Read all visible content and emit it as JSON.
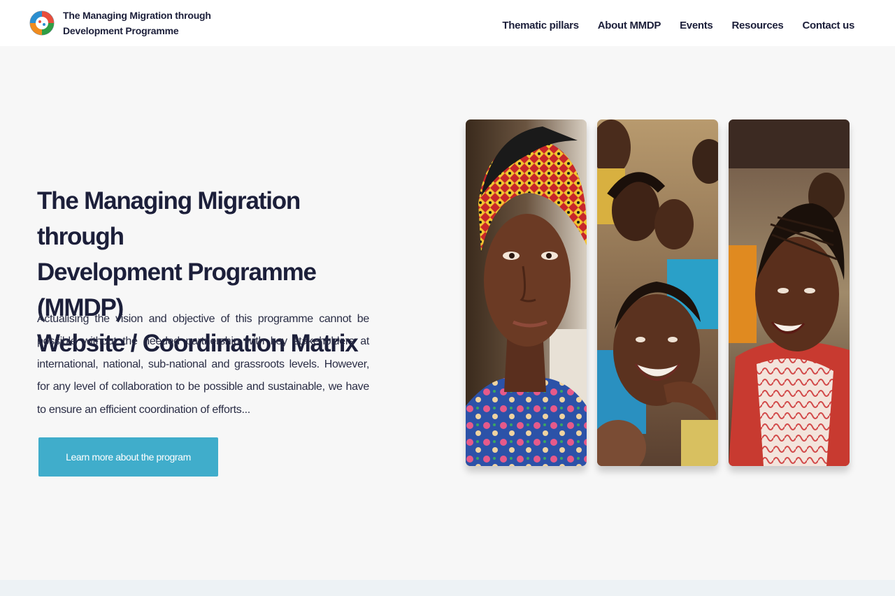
{
  "header": {
    "brand_line1": "The Managing Migration through",
    "brand_line2": "Development Programme",
    "logo_icon": "mmdp-logo-icon"
  },
  "nav": {
    "items": [
      {
        "label": "Thematic pillars"
      },
      {
        "label": "About MMDP"
      },
      {
        "label": "Events"
      },
      {
        "label": "Resources"
      },
      {
        "label": "Contact us"
      }
    ]
  },
  "hero": {
    "title_lines": [
      "The Managing Migration through",
      "Development Programme (MMDP)",
      "Website / Coordination Matrix"
    ],
    "text": "Actualising the vision and objective of this programme cannot be possible without the needed partnership with key stakeholders at international, national, sub-national and grassroots levels. However, for any level of collaboration to be possible and sustainable, we have to ensure an efficient coordination of efforts...",
    "cta_label": "Learn more about the program",
    "cta_color": "#40adcb"
  },
  "photos": [
    {
      "subject": "woman with patterned headscarf"
    },
    {
      "subject": "smiling children group"
    },
    {
      "subject": "laughing girl with braided hair"
    }
  ]
}
